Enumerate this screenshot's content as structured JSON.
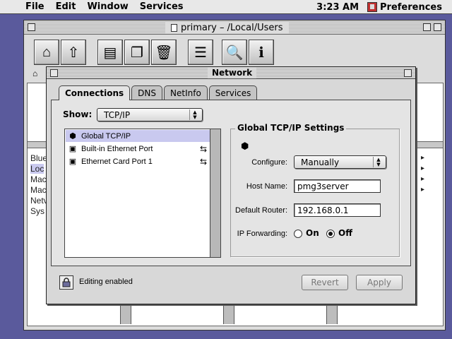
{
  "menubar": {
    "apple": "",
    "items": [
      "File",
      "Edit",
      "Window",
      "Services"
    ],
    "clock": "3:23 AM",
    "app_menu": "Preferences"
  },
  "finder_window": {
    "title": "primary – /Local/Users",
    "list_items": [
      "Blue",
      "Loc",
      "Mac",
      "Mac",
      "Netv",
      "Sys"
    ],
    "selected_index": 1,
    "toolbar_icons": [
      "home-icon",
      "upload-icon",
      "new-folder-icon",
      "copy-icon",
      "trash-icon",
      "inspector-icon",
      "find-icon",
      "info-icon"
    ]
  },
  "network": {
    "title": "Network",
    "tabs": [
      "Connections",
      "DNS",
      "NetInfo",
      "Services"
    ],
    "active_tab": 0,
    "show_label": "Show:",
    "show_value": "TCP/IP",
    "connections": [
      {
        "label": "Global TCP/IP",
        "selected": true
      },
      {
        "label": "Built-in Ethernet Port",
        "selected": false
      },
      {
        "label": "Ethernet Card Port 1",
        "selected": false
      }
    ],
    "settings": {
      "group_title": "Global TCP/IP Settings",
      "configure_label": "Configure:",
      "configure_value": "Manually",
      "host_name_label": "Host Name:",
      "host_name_value": "pmg3server",
      "router_label": "Default Router:",
      "router_value": "192.168.0.1",
      "forwarding_label": "IP Forwarding:",
      "on_label": "On",
      "off_label": "Off",
      "forwarding_value": "Off"
    },
    "footer": {
      "lock_status": "Editing enabled",
      "revert_label": "Revert",
      "apply_label": "Apply"
    }
  }
}
